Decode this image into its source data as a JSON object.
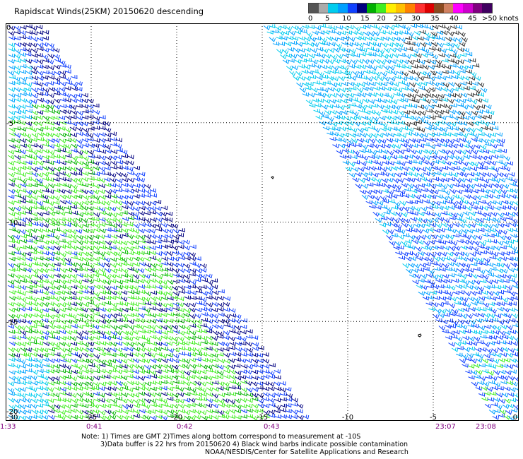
{
  "title": "Rapidscat Winds(25KM) 20150620 descending",
  "legend": {
    "colors": [
      "#555555",
      "#aaaaaa",
      "#00ccee",
      "#00a0ff",
      "#1040ff",
      "#000080",
      "#00b000",
      "#40ee20",
      "#ffee00",
      "#ffc000",
      "#ff8000",
      "#ff3030",
      "#dd0000",
      "#8a4a20",
      "#d08060",
      "#ff00ff",
      "#cc00cc",
      "#800080",
      "#400060"
    ],
    "labels": [
      "0",
      "5",
      "10",
      "15",
      "20",
      "25",
      "30",
      "35",
      "40",
      "45",
      ">50 knots"
    ]
  },
  "map": {
    "x_ticks": [
      "-30",
      "-25",
      "-20",
      "-15",
      "-10",
      "-5",
      "0"
    ],
    "y_ticks": [
      "0",
      "-5",
      "-10",
      "-15",
      "-20"
    ],
    "lon_range": [
      -30,
      0
    ],
    "lat_range": [
      -20,
      0
    ]
  },
  "times": [
    "1:33",
    "0:41",
    "0:42",
    "0:43",
    "23:07",
    "23:08"
  ],
  "footer": {
    "line1": "Note: 1) Times are GMT 2)Times along bottom correspond to measurement at -10S",
    "line2": "3)Data buffer is 22 hrs from 20150620 4) Black wind barbs indicate possible contamination",
    "line3": "NOAA/NESDIS/Center for Satellite Applications and Research"
  }
}
